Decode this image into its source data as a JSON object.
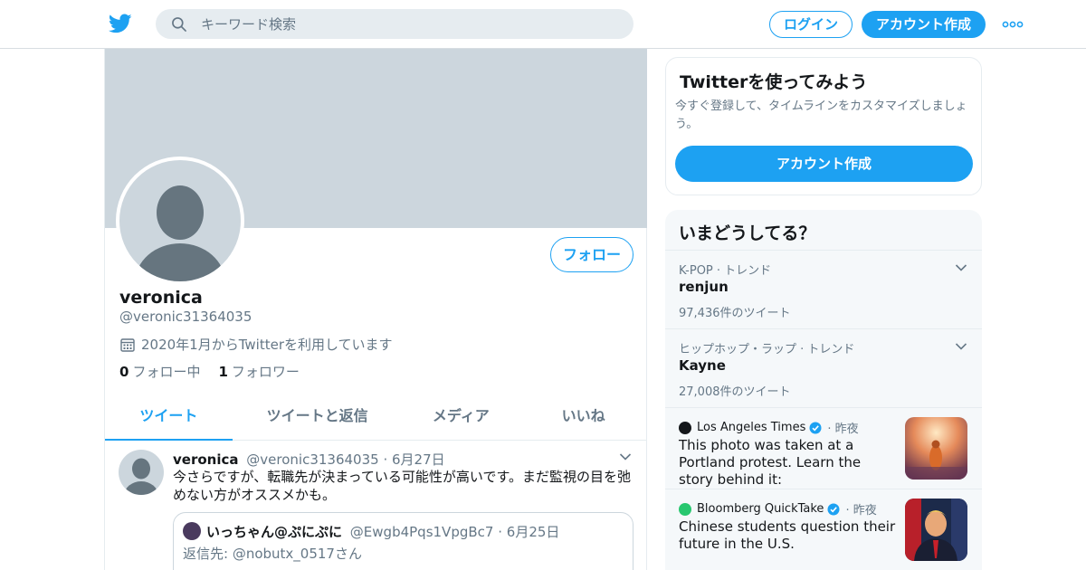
{
  "header": {
    "search_placeholder": "キーワード検索",
    "login_label": "ログイン",
    "signup_label": "アカウント作成"
  },
  "profile": {
    "follow_label": "フォロー",
    "name": "veronica",
    "handle": "@veronic31364035",
    "joined": "2020年1月からTwitterを利用しています",
    "following_count": "0",
    "following_label": "フォロー中",
    "followers_count": "1",
    "followers_label": "フォロワー",
    "tabs": [
      {
        "label": "ツイート",
        "active": true
      },
      {
        "label": "ツイートと返信",
        "active": false
      },
      {
        "label": "メディア",
        "active": false
      },
      {
        "label": "いいね",
        "active": false
      }
    ]
  },
  "tweet": {
    "name": "veronica",
    "handle": "@veronic31364035",
    "date": "6月27日",
    "text": "今さらですが、転職先が決まっている可能性が高いです。まだ監視の目を弛めない方がオススメかも。",
    "quote": {
      "name": "いっちゃん@ぷにぷに",
      "handle": "@Ewgb4Pqs1VpgBc7",
      "date": "6月25日",
      "reply_to": "返信先: @nobutx_0517さん"
    }
  },
  "sidebar": {
    "signup_card": {
      "title": "Twitterを使ってみよう",
      "description": "今すぐ登録して、タイムラインをカスタマイズしましょう。",
      "cta_label": "アカウント作成"
    },
    "trends_title": "いまどうしてる？",
    "trends": [
      {
        "meta": "K-POP · トレンド",
        "name": "renjun",
        "count": "97,436件のツイート"
      },
      {
        "meta": "ヒップホップ・ラップ · トレンド",
        "name": "Kayne",
        "count": "27,008件のツイート"
      }
    ],
    "news": [
      {
        "source": "Los Angeles Times",
        "when": "· 昨夜",
        "headline": "This photo was taken at a Portland protest. Learn the story behind it:"
      },
      {
        "source": "Bloomberg QuickTake",
        "when": "· 昨夜",
        "headline": "Chinese students question their future in the U.S."
      }
    ]
  },
  "colors": {
    "accent": "#1da1f2",
    "banner": "#ccd6dd",
    "muted_text": "#657786"
  }
}
